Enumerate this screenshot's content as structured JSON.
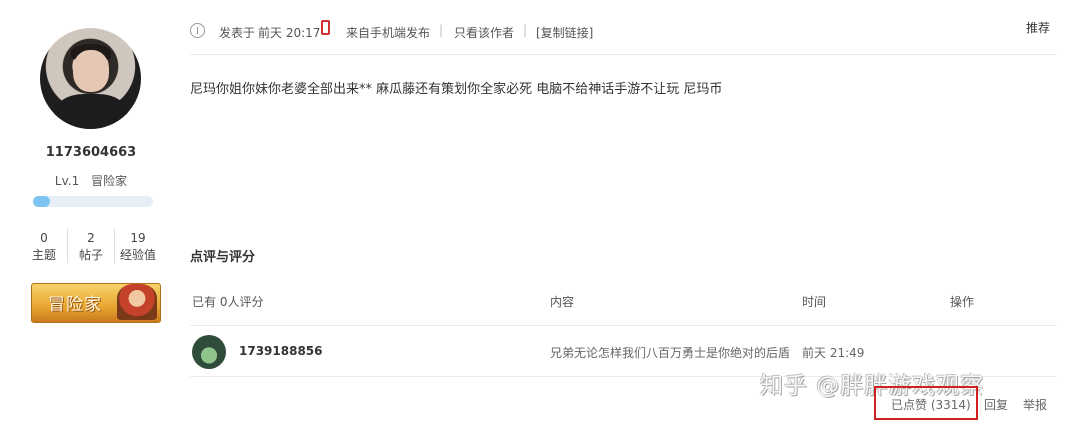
{
  "user": {
    "uid": "1173604663",
    "level": "Lv.1",
    "rank": "冒险家",
    "xp_progress": 0.14,
    "stats": [
      {
        "value": "0",
        "label": "主题"
      },
      {
        "value": "2",
        "label": "帖子"
      },
      {
        "value": "19",
        "label": "经验值"
      }
    ],
    "badge_text": "冒险家"
  },
  "post": {
    "posted_label": "发表于",
    "posted_time": "前天 20:17",
    "source": "来自手机端发布",
    "only_author": "只看该作者",
    "copy_link": "[复制链接]",
    "recommend": "推荐",
    "separator": "|",
    "body": "尼玛你姐你妹你老婆全部出来** 麻瓜藤还有策划你全家必死 电脑不给神话手游不让玩 尼玛币"
  },
  "ratings": {
    "title": "点评与评分",
    "columns": [
      "已有 0人评分",
      "内容",
      "时间",
      "操作"
    ],
    "rows": [
      {
        "user": "1739188856",
        "content": "兄弟无论怎样我们八百万勇士是你绝对的后盾",
        "time": "前天 21:49"
      }
    ]
  },
  "actions": {
    "liked": "已点赞 (3314)",
    "reply": "回复",
    "report": "举报"
  },
  "watermark": "知乎 @胖胖游戏观察",
  "colors": {
    "xp_fill": "#7ec4f0",
    "phone_icon": "#d03030",
    "highlight_box": "#d02020"
  }
}
